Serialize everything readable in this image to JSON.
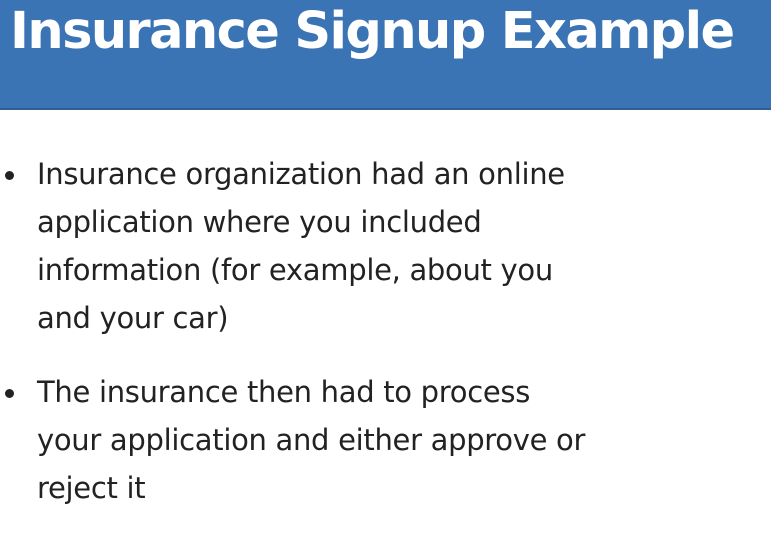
{
  "slide": {
    "title": "Insurance Signup Example",
    "bullets": [
      {
        "text": "Insurance organization had an online application where you included information (for example, about you and your car)"
      },
      {
        "text": "The insurance then had to process your application and either approve or reject it"
      }
    ]
  },
  "colors": {
    "title_bar": "#3b74b4",
    "title_text": "#ffffff",
    "body_text": "#222222"
  }
}
